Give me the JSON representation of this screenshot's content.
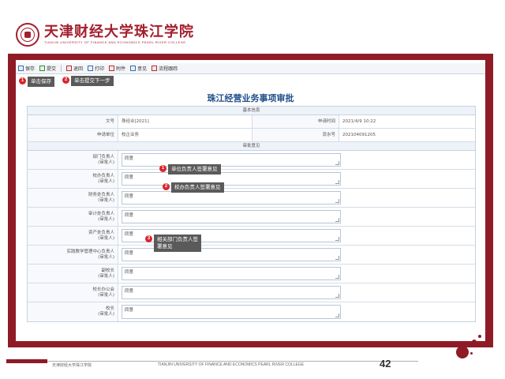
{
  "header": {
    "logo_cn": "天津财经大学珠江学院",
    "logo_en": "TIANJIN UNIVERSITY OF FINANCE AND ECONOMICS PEARL RIVER COLLEGE"
  },
  "toolbar": {
    "items": [
      "保存",
      "提交",
      "退回",
      "打印",
      "附件",
      "意见",
      "流程跟踪"
    ]
  },
  "callouts": [
    {
      "num": "1",
      "text": "单击保存"
    },
    {
      "num": "2",
      "text": "单击提交下一步"
    },
    {
      "num": "3",
      "text": "单位负责人签署意见"
    },
    {
      "num": "4",
      "text": "校办负责人签署意见"
    },
    {
      "num": "5",
      "text": "相关部门负责人签署意见"
    }
  ],
  "form": {
    "title": "珠江经营业务事项审批",
    "basic_section": "基本信息",
    "fields": [
      {
        "label": "文号",
        "value": "珠经业[2021]",
        "label2": "申请时间",
        "value2": "2021/4/9 10:22"
      },
      {
        "label": "申请单位",
        "value": "校企业务",
        "label2": "流水号",
        "value2": "202104091205"
      }
    ],
    "opinion_section": "审批意见",
    "opinions": [
      {
        "label": "部门负责人",
        "sub": "(审批人)",
        "value": "同意"
      },
      {
        "label": "校办负责人",
        "sub": "(审批人)",
        "value": "同意"
      },
      {
        "label": "财务处负责人",
        "sub": "(审批人)",
        "value": "同意"
      },
      {
        "label": "审计处负责人",
        "sub": "(审批人)",
        "value": "同意"
      },
      {
        "label": "资产处负责人",
        "sub": "(审批人)",
        "value": "同意"
      },
      {
        "label": "实践教学管理中心负责人",
        "sub": "(审批人)",
        "value": "同意"
      },
      {
        "label": "副校长",
        "sub": "(审批人)",
        "value": "同意"
      },
      {
        "label": "校长办公会",
        "sub": "(审批人)",
        "value": "同意"
      },
      {
        "label": "校长",
        "sub": "(审批人)",
        "value": "同意"
      }
    ]
  },
  "footer": {
    "cn": "天津财经大学珠江学院",
    "en": "TIANJIN UNIVERSITY OF FINANCE AND ECONOMICS PEARL RIVER COLLEGE",
    "page": "42"
  },
  "colors": {
    "brand": "#8f1b26",
    "title": "#1f4f8a",
    "badge": "#d9262c"
  }
}
